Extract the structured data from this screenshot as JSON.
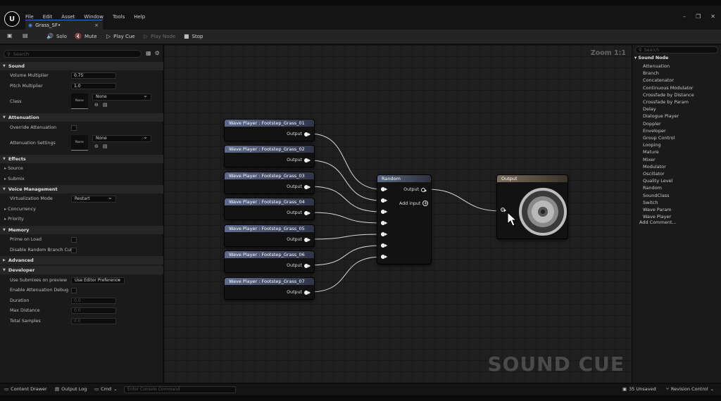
{
  "menu": {
    "items": [
      "File",
      "Edit",
      "Asset",
      "Window",
      "Tools",
      "Help"
    ]
  },
  "window_controls": {
    "minimize": "–",
    "restore": "❐",
    "close": "✕"
  },
  "tab": {
    "title": "Grass_SF•",
    "close": "×"
  },
  "toolbar": {
    "solo": "Solo",
    "mute": "Mute",
    "play_cue": "Play Cue",
    "play_node": "Play Node",
    "stop": "Stop"
  },
  "details": {
    "search_placeholder": "Search",
    "categories": {
      "sound": "Sound",
      "attenuation": "Attenuation",
      "effects": "Effects",
      "voice_management": "Voice Management",
      "memory": "Memory",
      "advanced": "Advanced",
      "developer": "Developer"
    },
    "props": {
      "volume_multiplier": {
        "label": "Volume Multiplier",
        "value": "0.75"
      },
      "pitch_multiplier": {
        "label": "Pitch Multiplier",
        "value": "1.0"
      },
      "class": {
        "label": "Class",
        "value": "None",
        "thumb": "None"
      },
      "override_attenuation": {
        "label": "Override Attenuation"
      },
      "attenuation_settings": {
        "label": "Attenuation Settings",
        "value": "None",
        "thumb": "None"
      },
      "source": {
        "label": "Source"
      },
      "submix": {
        "label": "Submix"
      },
      "virtualization_mode": {
        "label": "Virtualization Mode",
        "value": "Restart"
      },
      "concurrency": {
        "label": "Concurrency"
      },
      "priority": {
        "label": "Priority"
      },
      "prime_on_load": {
        "label": "Prime on Load"
      },
      "disable_random_branch": {
        "label": "Disable Random Branch Cul..."
      },
      "use_submixes": {
        "label": "Use Submixes on preview",
        "value": "Use Editor Preference"
      },
      "enable_attenuation_debug": {
        "label": "Enable Attenuation Debug"
      },
      "duration": {
        "label": "Duration",
        "value": "0.0"
      },
      "max_distance": {
        "label": "Max Distance",
        "value": "0.0"
      },
      "total_samples": {
        "label": "Total Samples",
        "value": "0.0"
      }
    }
  },
  "graph": {
    "zoom": "Zoom 1:1",
    "watermark": "SOUND CUE",
    "wave_players": [
      {
        "title": "Wave Player : Footstep_Grass_01",
        "pin": "Output"
      },
      {
        "title": "Wave Player : Footstep_Grass_02",
        "pin": "Output"
      },
      {
        "title": "Wave Player : Footstep_Grass_03",
        "pin": "Output"
      },
      {
        "title": "Wave Player : Footstep_Grass_04",
        "pin": "Output"
      },
      {
        "title": "Wave Player : Footstep_Grass_05",
        "pin": "Output"
      },
      {
        "title": "Wave Player : Footstep_Grass_06",
        "pin": "Output"
      },
      {
        "title": "Wave Player : Footstep_Grass_07",
        "pin": "Output"
      }
    ],
    "random": {
      "title": "Random",
      "output": "Output",
      "add_input": "Add input"
    },
    "output": {
      "title": "Output"
    }
  },
  "palette": {
    "search_placeholder": "Search",
    "category": "Sound Node",
    "items": [
      "Attenuation",
      "Branch",
      "Concatenator",
      "Continuous Modulator",
      "Crossfade by Distance",
      "Crossfade by Param",
      "Delay",
      "Dialogue Player",
      "Doppler",
      "Enveloper",
      "Group Control",
      "Looping",
      "Mature",
      "Mixer",
      "Modulator",
      "Oscillator",
      "Quality Level",
      "Random",
      "SoundClass",
      "Switch",
      "Wave Param",
      "Wave Player"
    ],
    "add_comment": "Add Comment..."
  },
  "statusbar": {
    "content_drawer": "Content Drawer",
    "output_log": "Output Log",
    "cmd": "Cmd",
    "console_placeholder": "Enter Console Command",
    "unsaved": "35 Unsaved",
    "revision_control": "Revision Control"
  }
}
